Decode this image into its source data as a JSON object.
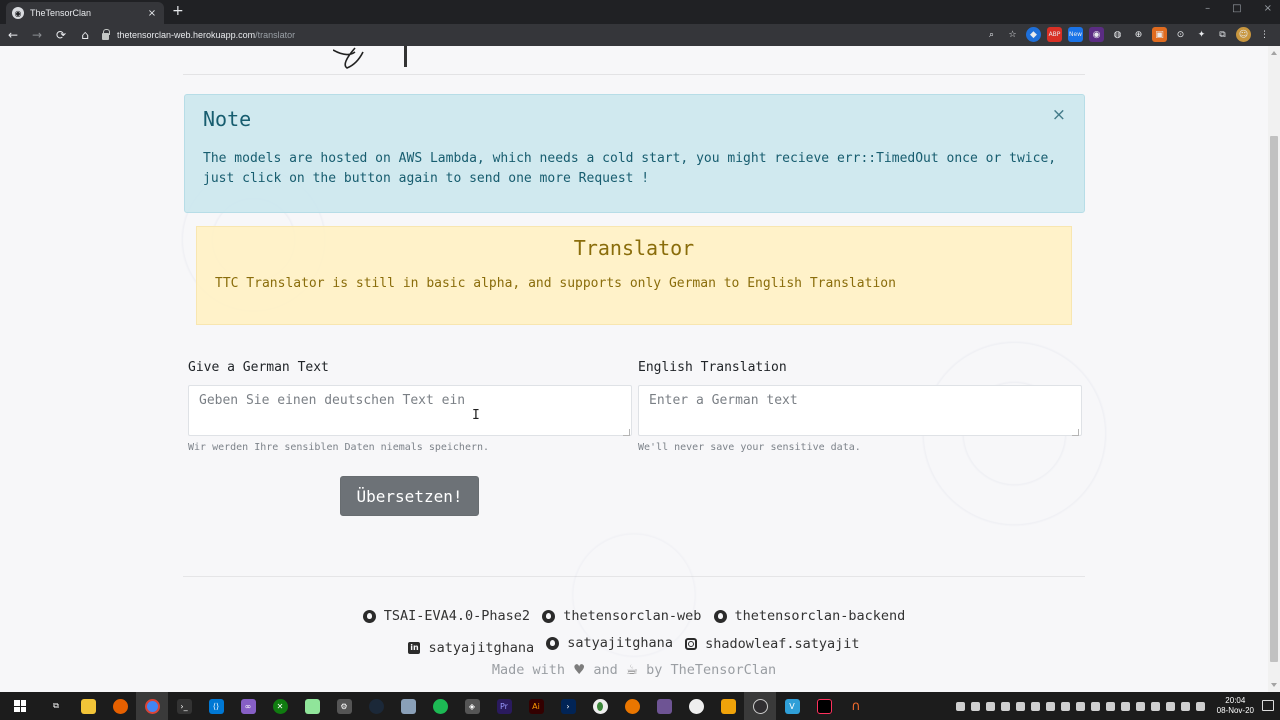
{
  "browser": {
    "tab_title": "TheTensorClan",
    "tab_close": "×",
    "new_tab": "+",
    "url_host": "thetensorclan-web.herokuapp.com",
    "url_path": "/translator",
    "nav": {
      "back": "←",
      "forward": "→",
      "reload": "⟳",
      "home": "⌂"
    },
    "window_controls": {
      "minimize": "–",
      "maximize": "□",
      "close": "×"
    },
    "toolbar_icons": [
      "zoom-icon",
      "bookmark-star-icon",
      "extension-1-icon",
      "adblock-icon",
      "extension-new-icon",
      "extension-3-icon",
      "extension-4-icon",
      "extension-5-icon",
      "extension-6-icon",
      "extension-7-icon",
      "extensions-puzzle-icon",
      "media-icon",
      "profile-avatar",
      "menu-icon"
    ],
    "new_badge": "New"
  },
  "note": {
    "title": "Note",
    "close": "×",
    "body": "The models are hosted on AWS Lambda, which needs a cold start, you might recieve err::TimedOut once or twice, just click on the button again to send one more Request !"
  },
  "translator_alert": {
    "title": "Translator",
    "body": "TTC Translator is still in basic alpha, and supports only German to English Translation"
  },
  "form": {
    "german": {
      "label": "Give a German Text",
      "placeholder": "Geben Sie einen deutschen Text ein",
      "value": "",
      "help": "Wir werden Ihre sensiblen Daten niemals speichern."
    },
    "english": {
      "label": "English Translation",
      "placeholder": "Enter a German text",
      "value": "",
      "help": "We'll never save your sensitive data."
    },
    "submit_label": "Übersetzen!"
  },
  "footer": {
    "repos": [
      {
        "label": "TSAI-EVA4.0-Phase2",
        "icon": "github-icon"
      },
      {
        "label": "thetensorclan-web",
        "icon": "github-icon"
      },
      {
        "label": "thetensorclan-backend",
        "icon": "github-icon"
      }
    ],
    "socials": [
      {
        "label": "satyajitghana",
        "icon": "linkedin-icon"
      },
      {
        "label": "satyajitghana",
        "icon": "github-icon"
      },
      {
        "label": "shadowleaf.satyajit",
        "icon": "instagram-icon"
      }
    ],
    "made_with": {
      "prefix": "Made with",
      "heart": "♥",
      "and": "and",
      "coffee": "☕",
      "suffix": "by TheTensorClan"
    }
  },
  "taskbar": {
    "apps": [
      "file-explorer-icon",
      "firefox-icon",
      "chrome-icon",
      "terminal-icon",
      "vscode-icon",
      "visual-studio-icon",
      "xbox-icon",
      "notepad-plus-icon",
      "settings-gear-icon",
      "steam-icon",
      "virtualbox-icon",
      "spotify-icon",
      "git-icon",
      "premiere-icon",
      "illustrator-icon",
      "powershell-icon",
      "node-icon",
      "blender-icon",
      "github-desktop-icon",
      "postman-icon",
      "vlc-icon",
      "obs-icon",
      "vue-icon",
      "intellij-icon",
      "origin-icon"
    ],
    "clock_time": "20:04",
    "clock_date": "08-Nov-20",
    "colors": {
      "bg": "#1c1c1c"
    }
  },
  "colors": {
    "info_bg": "#cce7ee",
    "info_text": "#175d6f",
    "warning_bg": "#fff1c4",
    "warning_text": "#8a6d0b",
    "button_bg": "#6d7277"
  }
}
